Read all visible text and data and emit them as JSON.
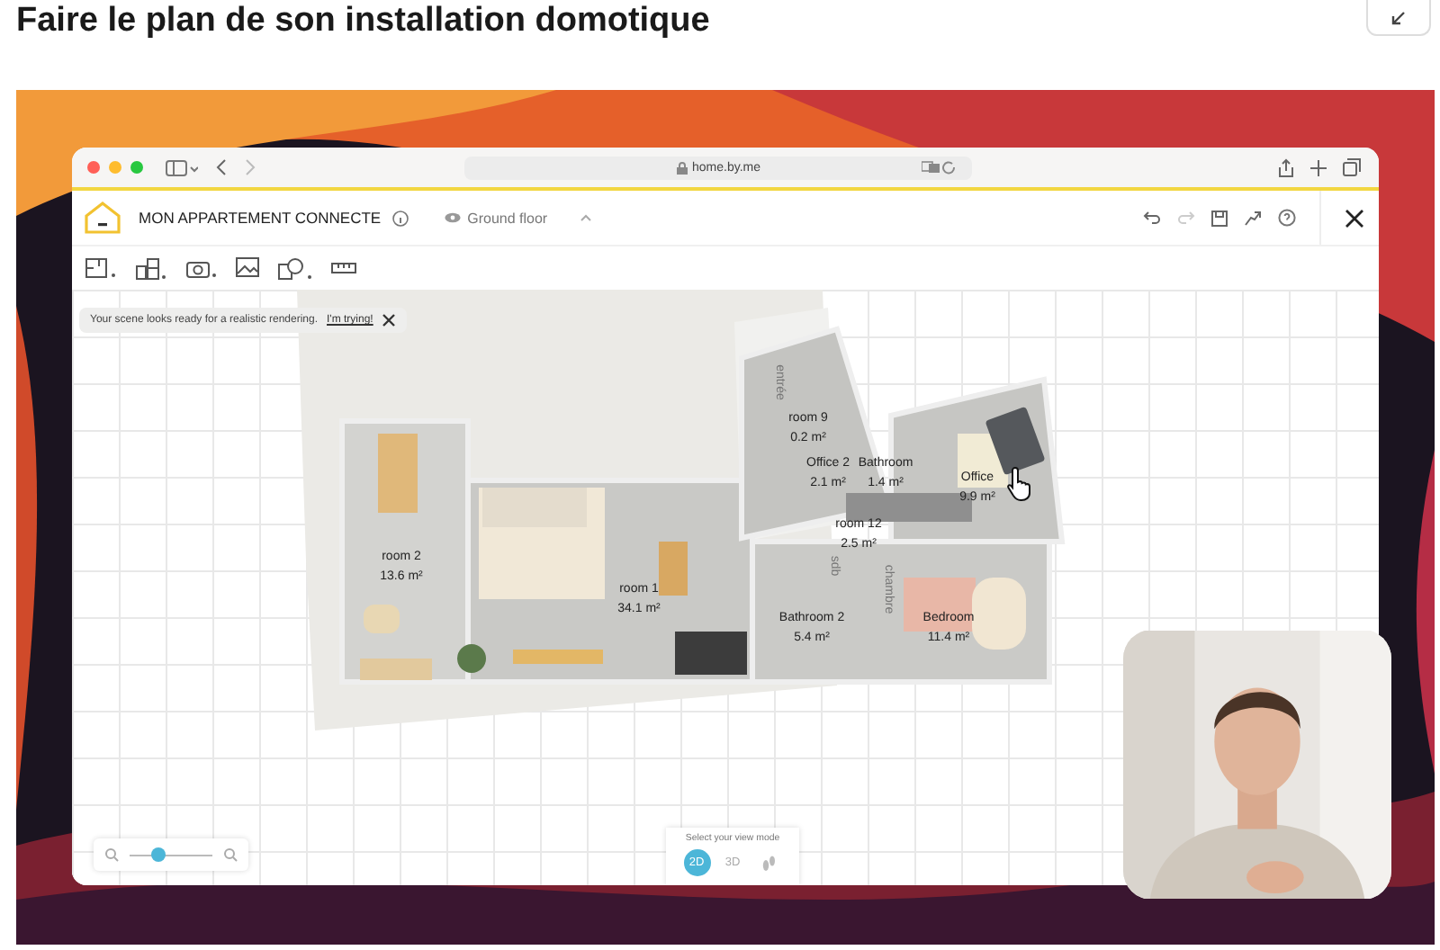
{
  "page": {
    "title": "Faire le plan de son installation domotique"
  },
  "video": {
    "kind": "picture",
    "browser": {
      "address": "home.by.me"
    },
    "app": {
      "project_title": "MON APPARTEMENT CONNECTE",
      "floor": "Ground floor",
      "notification": {
        "text": "Your scene looks ready for a realistic rendering.",
        "link": "I'm trying!"
      },
      "rooms": [
        {
          "name": "room 9",
          "area": "0.2 m²"
        },
        {
          "name": "Office 2",
          "area": "2.1 m²"
        },
        {
          "name": "Bathroom",
          "area": "1.4 m²"
        },
        {
          "name": "Office",
          "area": "9.9 m²"
        },
        {
          "name": "room 12",
          "area": "2.5 m²"
        },
        {
          "name": "room 2",
          "area": "13.6 m²"
        },
        {
          "name": "room 1",
          "area": "34.1 m²"
        },
        {
          "name": "Bathroom 2",
          "area": "5.4 m²"
        },
        {
          "name": "Bedroom",
          "area": "11.4 m²"
        }
      ],
      "plan_labels": [
        "entrée",
        "sdb",
        "chambre"
      ],
      "zoom": {
        "level": 0.35
      },
      "view_mode": {
        "prompt": "Select your view mode",
        "modes": [
          {
            "kind": "text",
            "label": "2D",
            "selected": true
          },
          {
            "kind": "text",
            "label": "3D",
            "selected": false
          },
          {
            "kind": "walk",
            "selected": false
          }
        ]
      }
    }
  }
}
